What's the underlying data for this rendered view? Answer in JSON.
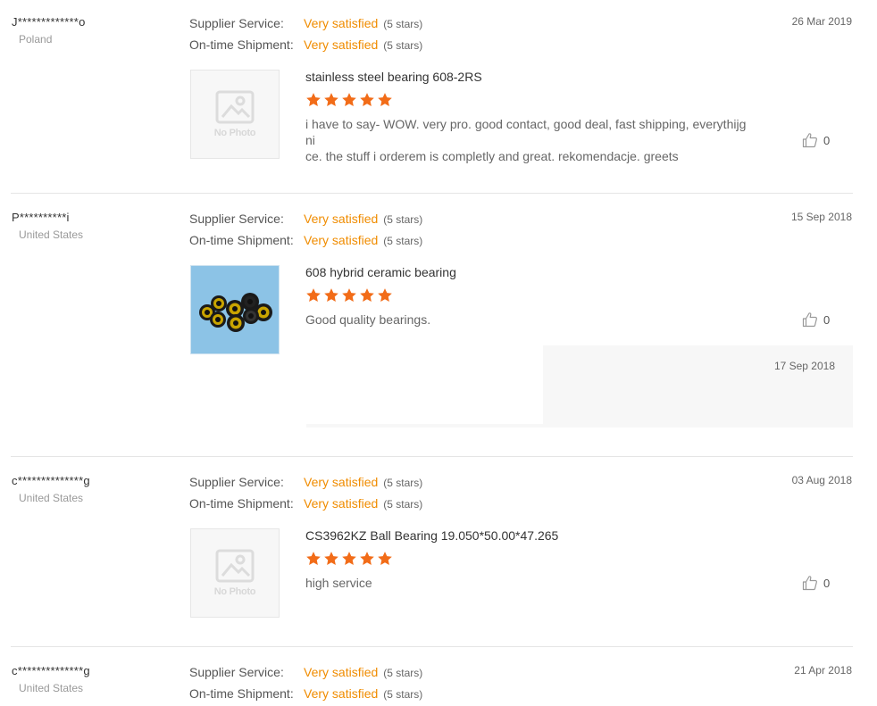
{
  "labels": {
    "supplier_service": "Supplier Service:",
    "ontime_shipment": "On-time Shipment:",
    "no_photo": "No Photo"
  },
  "colors": {
    "accent": "#f08c00",
    "star": "#f26c18"
  },
  "reviews": [
    {
      "buyer": "J*************o",
      "country": "Poland",
      "date": "26 Mar 2019",
      "supplier_rating": "Very satisfied",
      "supplier_stars": "(5 stars)",
      "shipment_rating": "Very satisfied",
      "shipment_stars": "(5 stars)",
      "product": "stainless steel bearing 608-2RS",
      "star_rating": 5,
      "text_line1": "i have to say- WOW.  very pro. good contact, good deal, fast shipping, everythijg ni",
      "text_line2": "ce. the stuff i orderem is completly and great. rekomendacje. greets",
      "helpful": "0",
      "image": "no-photo"
    },
    {
      "buyer": "P**********i",
      "country": "United States",
      "date": "15 Sep 2018",
      "supplier_rating": "Very satisfied",
      "supplier_stars": "(5 stars)",
      "shipment_rating": "Very satisfied",
      "shipment_stars": "(5 stars)",
      "product": "608 hybrid ceramic bearing",
      "star_rating": 5,
      "text_line1": "Good quality bearings.",
      "helpful": "0",
      "image": "bearing-photo",
      "reply_date": "17 Sep 2018"
    },
    {
      "buyer": "c**************g",
      "country": "United States",
      "date": "03 Aug 2018",
      "supplier_rating": "Very satisfied",
      "supplier_stars": "(5 stars)",
      "shipment_rating": "Very satisfied",
      "shipment_stars": "(5 stars)",
      "product": "CS3962KZ Ball Bearing 19.050*50.00*47.265",
      "star_rating": 5,
      "text_line1": "high service",
      "helpful": "0",
      "image": "no-photo"
    },
    {
      "buyer": "c**************g",
      "country": "United States",
      "date": "21 Apr 2018",
      "supplier_rating": "Very satisfied",
      "supplier_stars": "(5 stars)",
      "shipment_rating": "Very satisfied",
      "shipment_stars": "(5 stars)"
    }
  ]
}
